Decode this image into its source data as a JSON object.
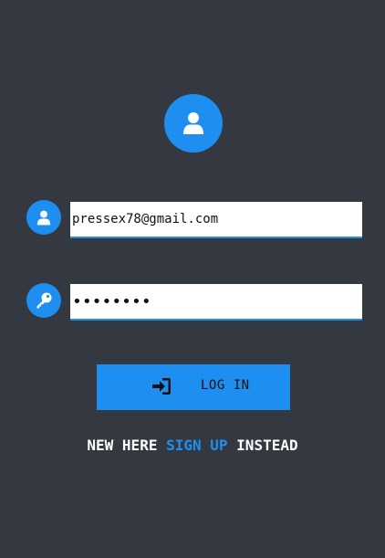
{
  "login_form": {
    "avatar_icon": "user-icon",
    "email_icon": "user-icon",
    "password_icon": "key-icon",
    "email_value": "pressex78@gmail.com",
    "password_value": "••••••••",
    "login_button_icon": "sign-in-icon",
    "login_button_label": "LOG IN",
    "signup_prefix": "NEW HERE",
    "signup_link": "SIGN UP",
    "signup_suffix": "INSTEAD"
  },
  "colors": {
    "background": "#343840",
    "accent": "#1e8ff0",
    "input_background": "#ffffff",
    "text_light": "#ffffff",
    "text_dark": "#111111"
  }
}
